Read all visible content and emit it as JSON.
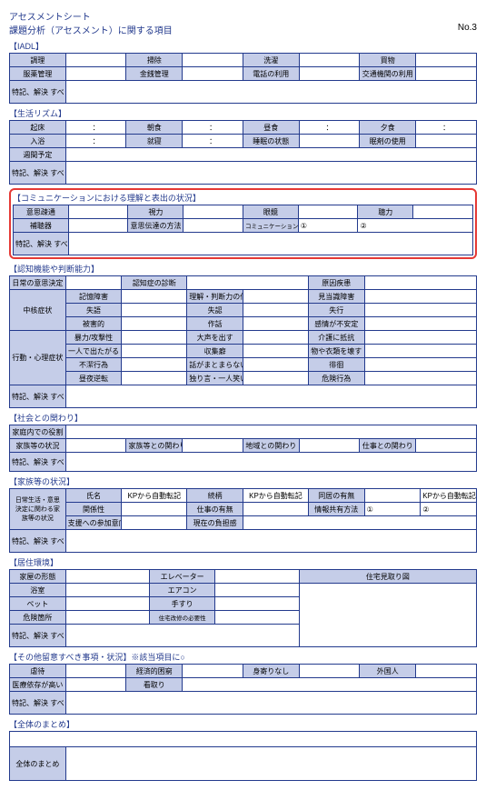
{
  "header": {
    "title1": "アセスメントシート",
    "title2": "課題分析（アセスメント）に関する項目",
    "page": "No.3"
  },
  "sections": {
    "iadl": "【IADL】",
    "rhythm": "【生活リズム】",
    "comm": "【コミュニケーションにおける理解と表出の状況】",
    "cog": "【認知機能や判断能力】",
    "social": "【社会との関わり】",
    "family": "【家族等の状況】",
    "housing": "【居住環境】",
    "other": "【その他留意すべき事項・状況】※該当項目に○",
    "summary": "【全体のまとめ】"
  },
  "iadl": {
    "r1": [
      "調理",
      "",
      "掃除",
      "",
      "洗濯",
      "",
      "買物",
      ""
    ],
    "r2": [
      "服薬管理",
      "",
      "金銭管理",
      "",
      "電話の利用",
      "",
      "交通機関の利用",
      ""
    ],
    "notes": "特記、解決\nすべき課題など"
  },
  "rhythm": {
    "r1": [
      "起床",
      "：",
      "朝食",
      "：",
      "昼食",
      "：",
      "夕食",
      "："
    ],
    "r2": [
      "入浴",
      "：",
      "就寝",
      "：",
      "睡眠の状態",
      "",
      "眠剤の使用",
      ""
    ],
    "weekly": "週間予定",
    "notes": "特記、解決\nすべき課題など"
  },
  "comm": {
    "r1": [
      "意思疎通",
      "",
      "視力",
      "",
      "眼鏡",
      "",
      "聴力",
      ""
    ],
    "r2c1": "補聴器",
    "r2c3": "意思伝達の方法",
    "r2c5": "コミュニケーションツール",
    "r2c6": "①",
    "r2c8": "②",
    "notes": "特記、解決\nすべき課題など"
  },
  "cog": {
    "r1": [
      "日常の意思決定",
      "",
      "認知症の診断",
      "",
      "原因疾患",
      ""
    ],
    "core": "中核症状",
    "core_rows": [
      [
        "記憶障害",
        "",
        "理解・判断力の低下",
        "",
        "見当識障害",
        ""
      ],
      [
        "失語",
        "",
        "失認",
        "",
        "失行",
        ""
      ],
      [
        "被害的",
        "",
        "作話",
        "",
        "感情が不安定",
        ""
      ]
    ],
    "bpsd": "行動・心理症状",
    "bpsd_rows": [
      [
        "暴力/攻撃性",
        "",
        "大声を出す",
        "",
        "介護に抵抗",
        ""
      ],
      [
        "一人で出たがる",
        "",
        "収集癖",
        "",
        "物や衣類を壊す",
        ""
      ],
      [
        "不潔行為",
        "",
        "話がまとまらない",
        "",
        "徘徊",
        ""
      ],
      [
        "昼夜逆転",
        "",
        "独り言・一人笑い",
        "",
        "危険行為",
        ""
      ]
    ],
    "notes": "特記、解決\nすべき課題など"
  },
  "social": {
    "role": "家庭内での役割",
    "r2": [
      "家族等の状況",
      "",
      "家族等との関わり",
      "",
      "地域との関わり",
      "",
      "仕事との関わり",
      ""
    ],
    "notes": "特記、解決\nすべき課題など"
  },
  "family": {
    "h": [
      "",
      "氏名",
      "KPから自動転記",
      "続柄",
      "KPから自動転記",
      "同居の有無",
      "",
      "KPから自動転記"
    ],
    "lbl_main": "日常生活・意思\n決定に関わる家\n族等の状況",
    "r2": [
      "関係性",
      "",
      "仕事の有無",
      "",
      "情報共有方法",
      "①",
      "②"
    ],
    "r3": [
      "支援への参加意向",
      "",
      "現在の負担感",
      ""
    ],
    "notes": "特記、解決\nすべき課題など"
  },
  "housing": {
    "r1": [
      "家屋の形態",
      "",
      "エレベーター",
      "",
      "住宅見取り図"
    ],
    "r2": [
      "浴室",
      "",
      "エアコン",
      ""
    ],
    "r3": [
      "ペット",
      "",
      "手すり",
      ""
    ],
    "r4": [
      "危険箇所",
      "",
      "住宅改修の必要性",
      ""
    ],
    "notes": "特記、解決\nすべき課題など"
  },
  "other": {
    "r1": [
      "虐待",
      "",
      "経済的困窮",
      "",
      "身寄りなし",
      "",
      "外国人",
      ""
    ],
    "r2": [
      "医療依存が高い",
      "",
      "看取り",
      ""
    ],
    "notes": "特記、解決\nすべき課題など"
  },
  "summary": {
    "label": "全体のまとめ"
  }
}
